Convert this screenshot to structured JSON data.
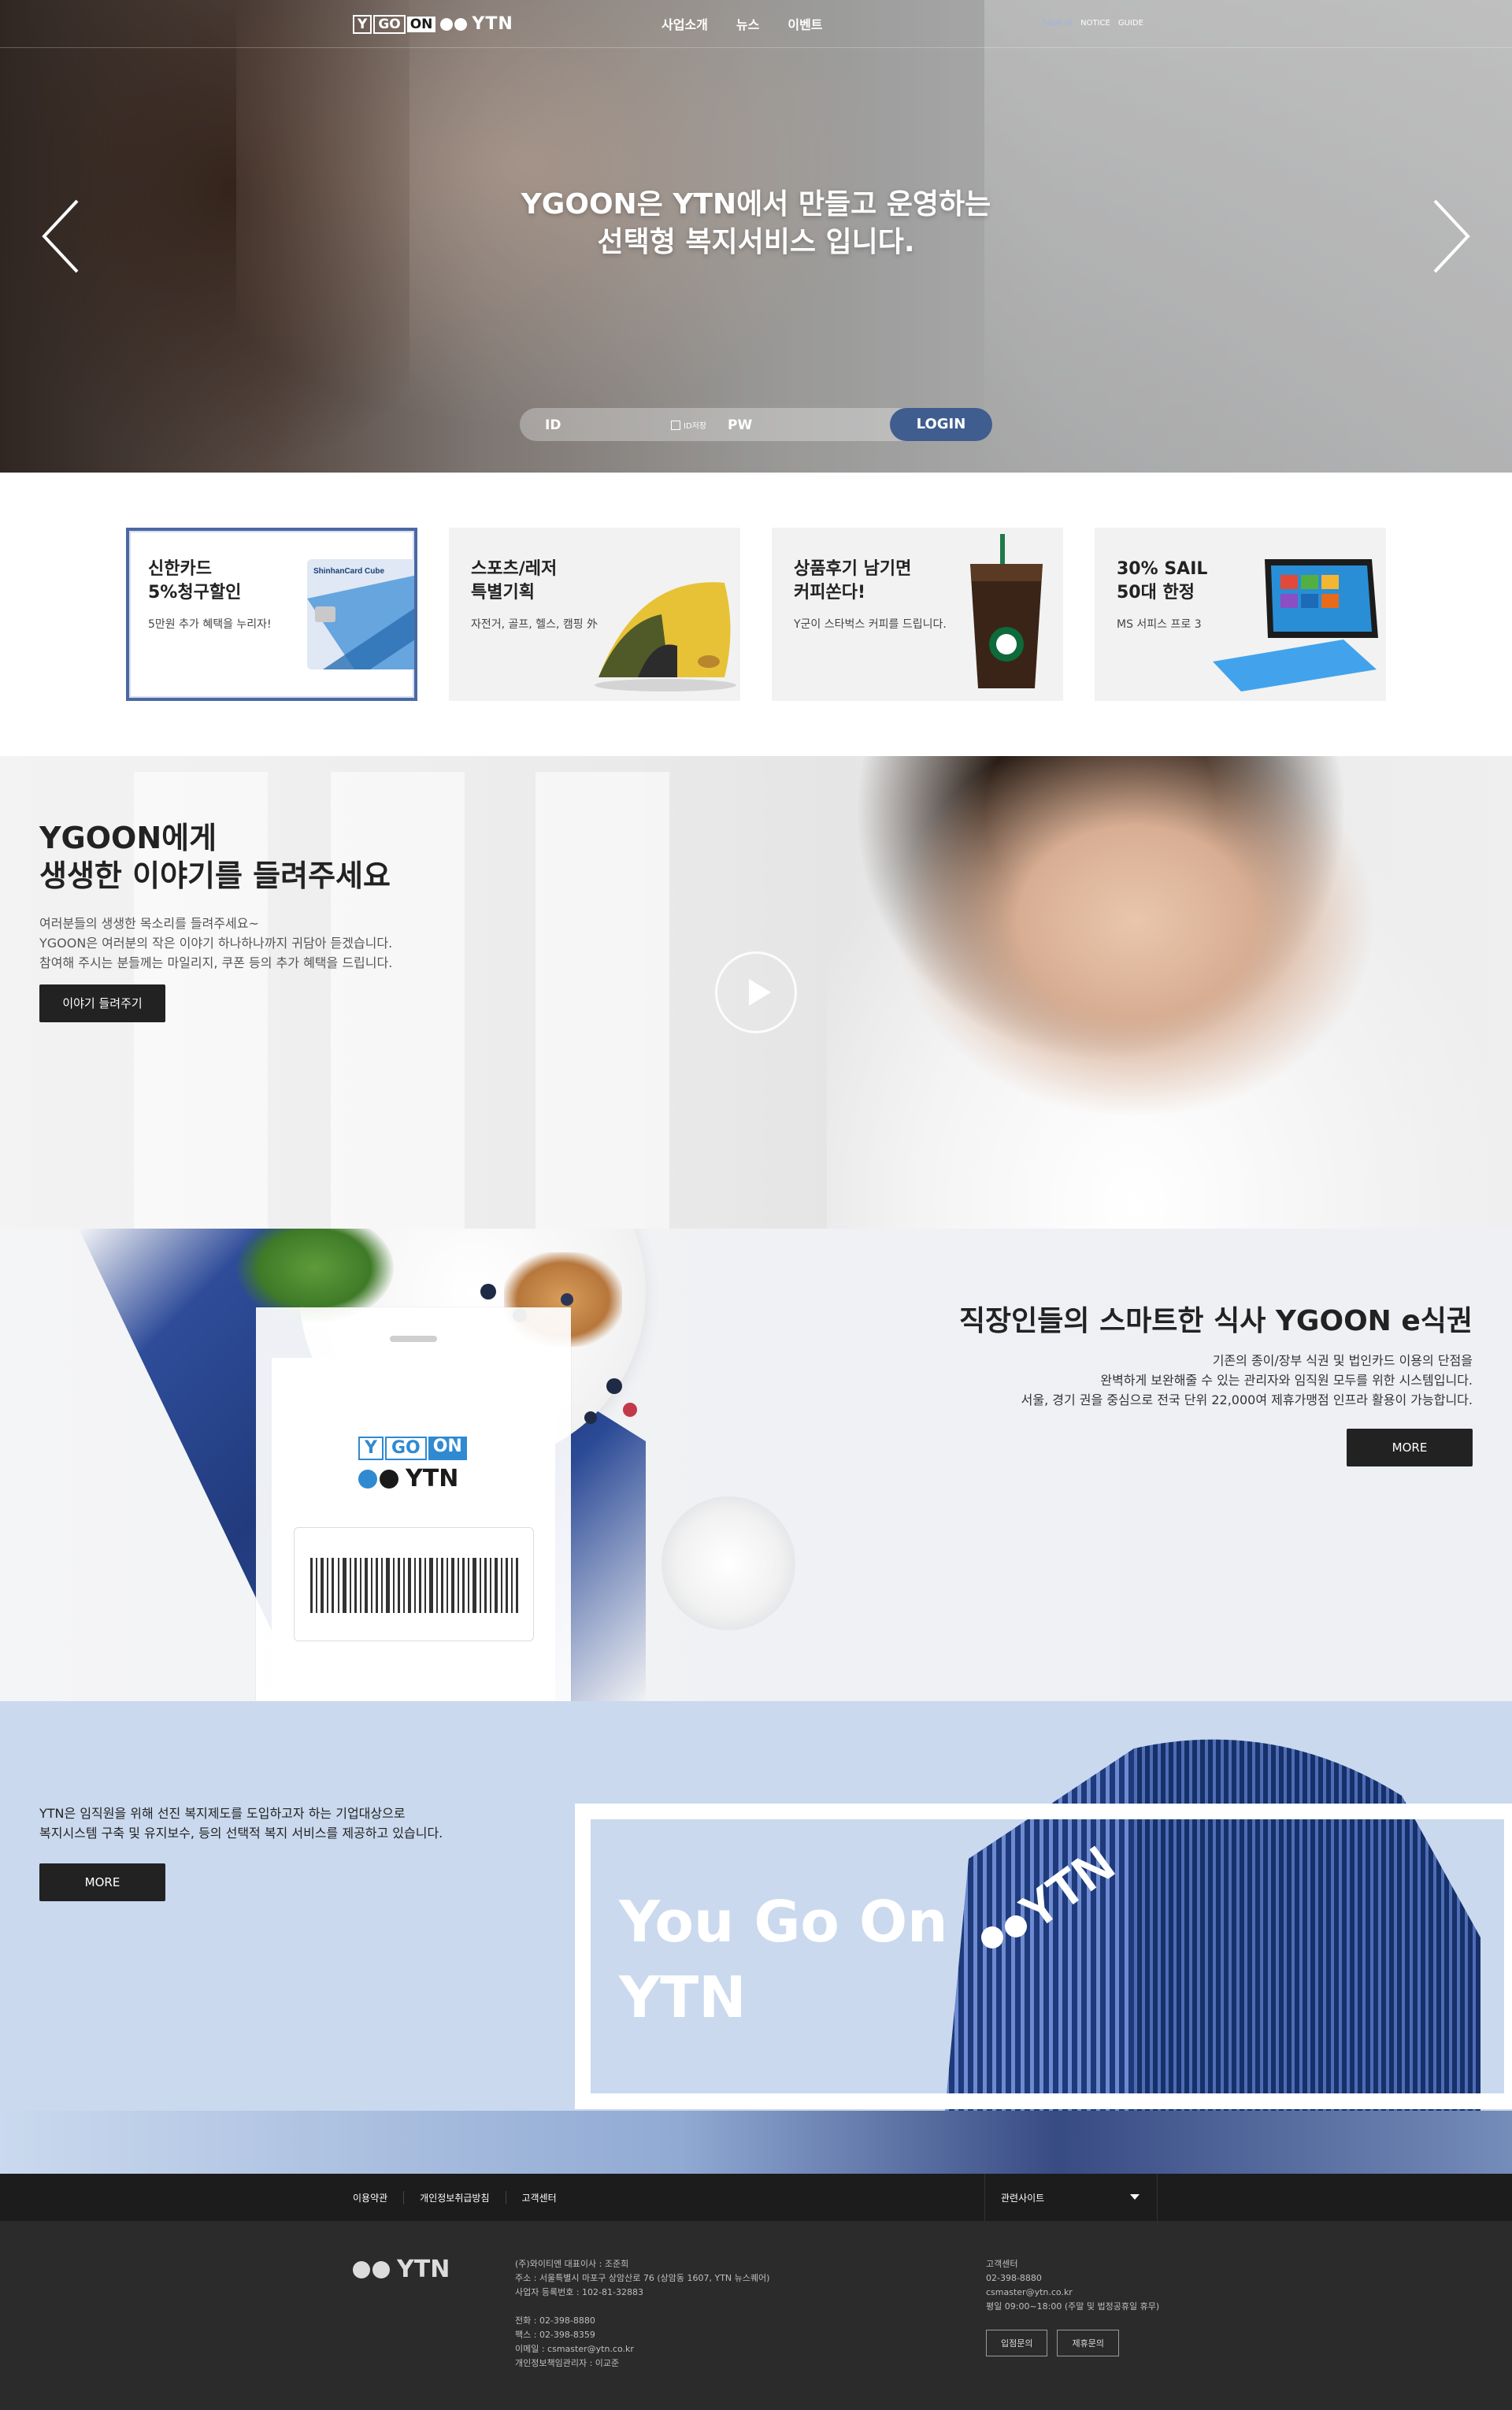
{
  "header": {
    "logo": {
      "y": "Y",
      "go": "GO",
      "on": "ON",
      "ytn": "YTN"
    },
    "nav": [
      "사업소개",
      "뉴스",
      "이벤트"
    ],
    "util": [
      "SIGN IN",
      "NOTICE",
      "GUIDE"
    ]
  },
  "hero": {
    "title_line1": "YGOON은 YTN에서 만들고 운영하는",
    "title_line2": "선택형 복지서비스 입니다.",
    "login": {
      "id_label": "ID",
      "pw_label": "PW",
      "save_label": "ID저장",
      "button": "LOGIN"
    }
  },
  "promos": [
    {
      "title1": "신한카드",
      "title2": "5%청구할인",
      "desc": "5만원 추가 혜택을 누리자!",
      "image_label": "ShinhanCard Cube"
    },
    {
      "title1": "스포츠/레저",
      "title2": "특별기획",
      "desc": "자전거, 골프, 헬스, 캠핑 外",
      "image_label": ""
    },
    {
      "title1": "상품후기 남기면",
      "title2": "커피쏜다!",
      "desc": "Y군이 스타벅스 커피를 드립니다.",
      "image_label": ""
    },
    {
      "title1": "30% SAIL",
      "title2": "50대 한정",
      "desc": "MS 서피스 프로 3",
      "image_label": ""
    }
  ],
  "story": {
    "title_line1": "YGOON에게",
    "title_line2": "생생한 이야기를 들려주세요",
    "desc": [
      "여러분들의 생생한 목소리를 들려주세요~",
      "YGOON은 여러분의 작은 이야기 하나하나까지 귀담아 듣겠습니다.",
      "참여해 주시는 분들께는 마일리지, 쿠폰 등의 추가 혜택을 드립니다."
    ],
    "button": "이야기 들려주기"
  },
  "emeal": {
    "title": "직장인들의 스마트한 식사 YGOON e식권",
    "desc": [
      "기존의 종이/장부 식권 및 법인카드 이용의 단점을",
      "완벽하게 보완해줄 수 있는 관리자와 임직원 모두를 위한 시스템입니다.",
      "서울, 경기 권을 중심으로 전국 단위 22,000여 제휴가맹점 인프라 활용이 가능합니다."
    ],
    "button": "MORE",
    "phone_logo": {
      "y": "Y",
      "go": "GO",
      "on": "ON",
      "ytn": "YTN"
    }
  },
  "about": {
    "desc": [
      "YTN은 임직원을 위해 선진 복지제도를 도입하고자 하는 기업대상으로",
      "복지시스템 구축 및 유지보수, 등의 선택적 복지 서비스를 제공하고 있습니다."
    ],
    "button": "MORE",
    "slogan_line1": "You Go On",
    "slogan_line2": "YTN",
    "building_sign": "YTN"
  },
  "footer": {
    "links": [
      "이용약관",
      "개인정보취급방침",
      "고객센터"
    ],
    "related": "관련사이트",
    "logo_text": "YTN",
    "address": [
      "(주)와이티엔 대표이사 : 조준희",
      "주소 : 서울특별시 마포구 상암산로 76 (상암동 1607, YTN 뉴스퀘어)",
      "사업자 등록번호 : 102-81-32883",
      "",
      "전화 : 02-398-8880",
      "팩스 : 02-398-8359",
      "이메일 : csmaster@ytn.co.kr",
      "개인정보책임관리자 : 이교준"
    ],
    "cs": [
      "고객센터",
      "02-398-8880",
      "csmaster@ytn.co.kr",
      "평일 09:00~18:00 (주말 및 법정공휴일 휴무)"
    ],
    "buttons": [
      "입점문의",
      "제휴문의"
    ]
  },
  "colors": {
    "accent_blue": "#3f5d8f",
    "active_card_border": "#4a68a3",
    "logo_blue": "#2f8ad1",
    "about_bg": "#cad9ee",
    "footer_bg": "#2b2b2b"
  }
}
